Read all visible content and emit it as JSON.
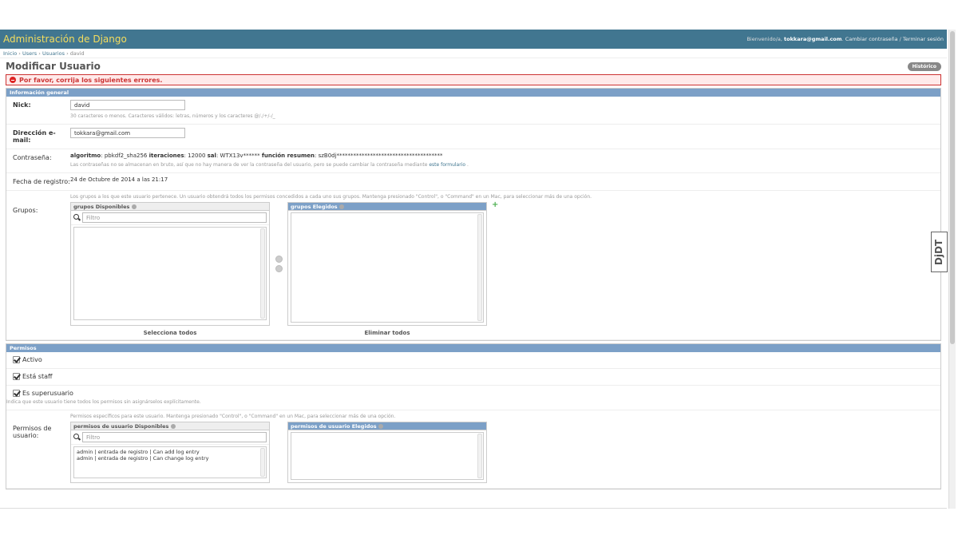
{
  "header": {
    "brand": "Administración de Django",
    "welcome": "Bienvenido/a,",
    "user_email": "tokkara@gmail.com",
    "change_password": "Cambiar contraseña",
    "separator": "/",
    "logout": "Terminar sesión"
  },
  "breadcrumbs": {
    "home": "Inicio",
    "sep": "›",
    "app": "Users",
    "model": "Usuarios",
    "current": "david"
  },
  "page": {
    "title": "Modificar Usuario",
    "history_button": "Histórico",
    "error": "Por favor, corrija los siguientes errores."
  },
  "general": {
    "heading": "Información general",
    "nick_label": "Nick:",
    "nick_value": "david",
    "nick_help": "30 caracteres o menos. Caracteres válidos: letras, números y los caracteres @/./+/-/_",
    "email_label": "Dirección e-mail:",
    "email_value": "tokkara@gmail.com",
    "password_label": "Contraseña:",
    "pwd_algo_key": "algoritmo",
    "pwd_algo_val": ": pbkdf2_sha256",
    "pwd_iter_key": "iteraciones",
    "pwd_iter_val": ": 12000",
    "pwd_salt_key": "sal",
    "pwd_salt_val": ": WTX13v******",
    "pwd_hash_key": "función resumen",
    "pwd_hash_val": ": szB0dj**************************************",
    "password_help": "Las contraseñas no se almacenan en bruto, así que no hay manera de ver la contraseña del usuario, pero se puede cambiar la contraseña mediante",
    "password_link": "este formulario",
    "password_help_end": ".",
    "date_label": "Fecha de registro:",
    "date_value": "24 de Octubre de 2014 a las 21:17",
    "groups_label": "Grupos:",
    "groups_help": "Los grupos a los que este usuario pertenece. Un usuario obtendrá todos los permisos concedidos a cada uno sus grupos. Mantenga presionado \"Control\", o \"Command\" en un Mac, para seleccionar más de una opción.",
    "groups_available": "grupos Disponibles",
    "groups_chosen": "grupos Elegidos",
    "filter_placeholder": "Filtro",
    "select_all": "Selecciona todos",
    "remove_all": "Eliminar todos"
  },
  "permissions": {
    "heading": "Permisos",
    "active": "Activo",
    "staff": "Está staff",
    "superuser": "Es superusuario",
    "superuser_help": "Indica que este usuario tiene todos los permisos sin asignárselos explícitamente.",
    "user_perms_label": "Permisos de usuario:",
    "user_perms_help": "Permisos específicos para este usuario. Mantenga presionado \"Control\", o \"Command\" en un Mac, para seleccionar más de una opción.",
    "available": "permisos de usuario Disponibles",
    "chosen": "permisos de usuario Elegidos",
    "filter_placeholder": "Filtro",
    "items": [
      "admin | entrada de registro | Can add log entry",
      "admin | entrada de registro | Can change log entry"
    ]
  },
  "toolbar": {
    "djdt": "DjDT"
  }
}
